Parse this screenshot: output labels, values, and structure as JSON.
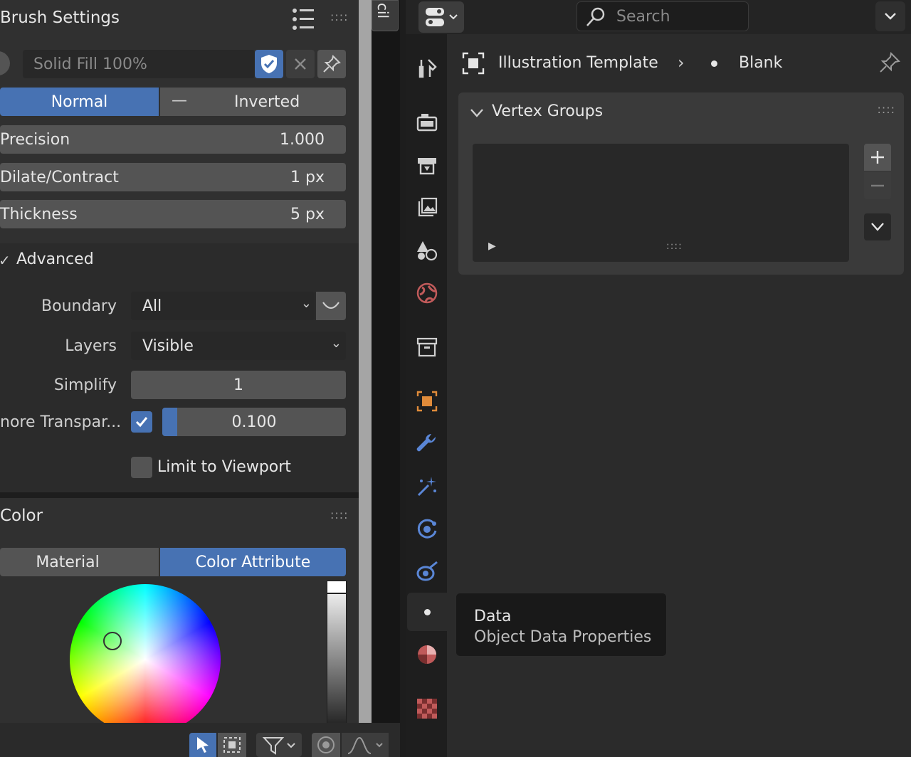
{
  "left_panel": {
    "title": "Brush Settings",
    "brush_field": {
      "value": "Solid Fill 100%"
    },
    "mode_buttons": {
      "normal": "Normal",
      "inverted": "Inverted",
      "inverted_icon": "minus-icon"
    },
    "fields": [
      {
        "label": "Precision",
        "value": "1.000"
      },
      {
        "label": "Dilate/Contract",
        "value": "1 px"
      },
      {
        "label": "Thickness",
        "value": "5 px"
      }
    ],
    "advanced": {
      "title": "Advanced",
      "boundary_label": "Boundary",
      "boundary_value": "All",
      "layers_label": "Layers",
      "layers_value": "Visible",
      "simplify_label": "Simplify",
      "simplify_value": "1",
      "ignore_transparent_label": "nore Transpar...",
      "ignore_transparent_checked": true,
      "ignore_transparent_value": "0.100",
      "ignore_transparent_fraction": 0.1,
      "limit_viewport_label": "Limit to Viewport",
      "limit_viewport_checked": false
    },
    "color_panel": {
      "title": "Color",
      "tab_material": "Material",
      "tab_color_attribute": "Color Attribute",
      "active_tab": "Color Attribute"
    }
  },
  "top_left_tab_label": "cil",
  "header": {
    "search_placeholder": "Search"
  },
  "breadcrumb": {
    "object": "Illustration Template",
    "data": "Blank"
  },
  "vertex_groups": {
    "title": "Vertex Groups"
  },
  "tooltip": {
    "title": "Data",
    "subtitle": "Object Data Properties"
  },
  "colors": {
    "accent": "#4772b3",
    "panel": "#303030",
    "field": "#545454"
  }
}
